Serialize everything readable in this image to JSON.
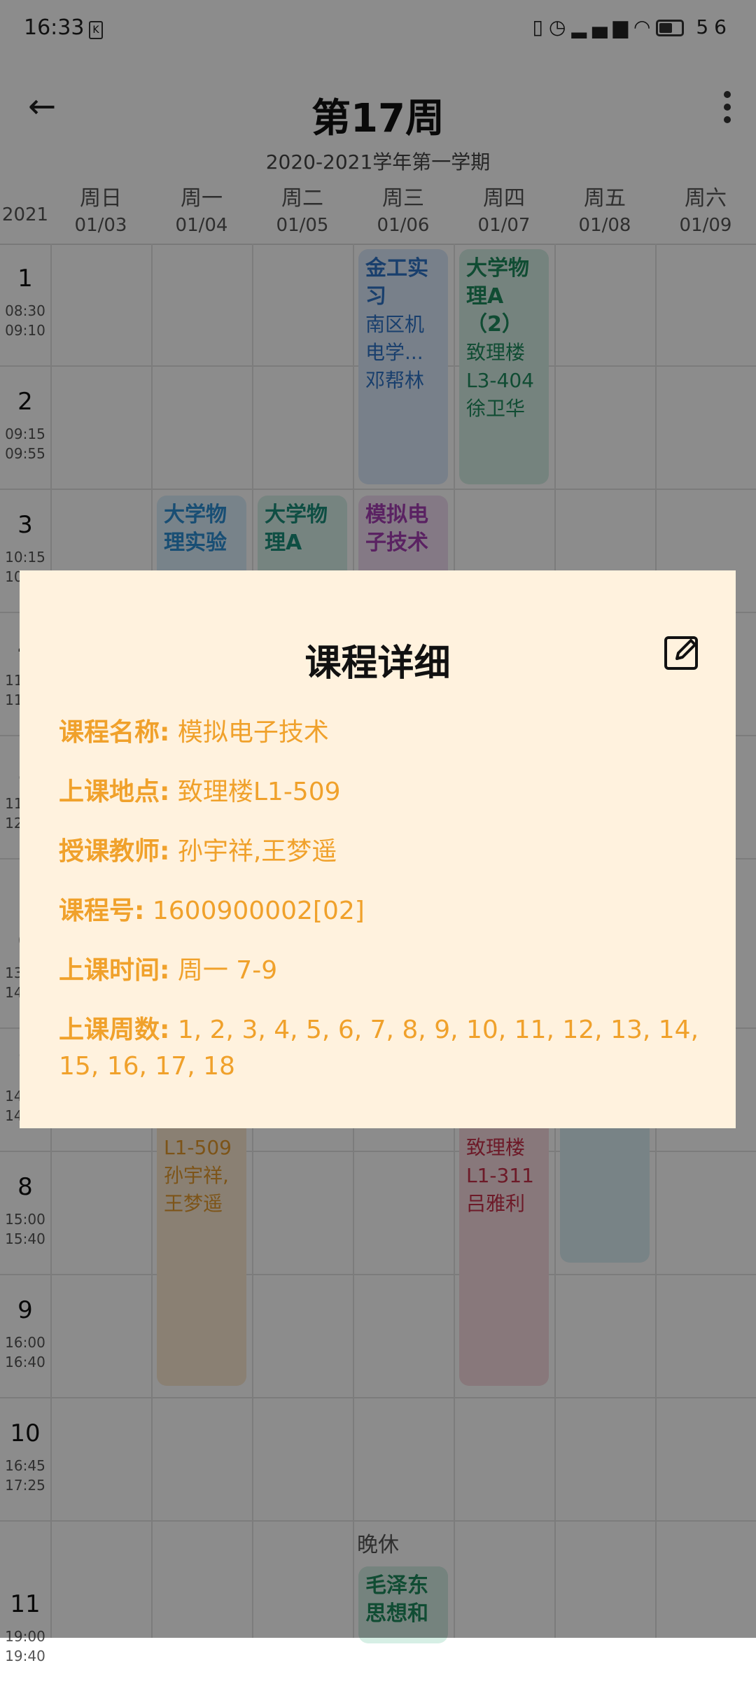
{
  "status_bar": {
    "time": "16:33",
    "battery": "56"
  },
  "header": {
    "title": "第17周",
    "subtitle": "2020-2021学年第一学期"
  },
  "day_header": {
    "year": "2021",
    "days": [
      {
        "name": "周日",
        "date": "01/03"
      },
      {
        "name": "周一",
        "date": "01/04"
      },
      {
        "name": "周二",
        "date": "01/05"
      },
      {
        "name": "周三",
        "date": "01/06"
      },
      {
        "name": "周四",
        "date": "01/07"
      },
      {
        "name": "周五",
        "date": "01/08"
      },
      {
        "name": "周六",
        "date": "01/09"
      }
    ]
  },
  "periods": [
    {
      "num": "1",
      "start": "08:30",
      "end": "09:10"
    },
    {
      "num": "2",
      "start": "09:15",
      "end": "09:55"
    },
    {
      "num": "3",
      "start": "10:15",
      "end": "10:55"
    },
    {
      "num": "4",
      "start": "11:00",
      "end": "11:40"
    },
    {
      "num": "5",
      "start": "11:45",
      "end": "12:25"
    },
    {
      "num": "6",
      "start": "13:30",
      "end": "14:10"
    },
    {
      "num": "7",
      "start": "14:15",
      "end": "14:55"
    },
    {
      "num": "8",
      "start": "15:00",
      "end": "15:40"
    },
    {
      "num": "9",
      "start": "16:00",
      "end": "16:40"
    },
    {
      "num": "10",
      "start": "16:45",
      "end": "17:25"
    },
    {
      "num": "11",
      "start": "19:00",
      "end": "19:40"
    }
  ],
  "break_label": "晚休",
  "courses": {
    "c1": {
      "name": "金工实习",
      "room": "南区机电学...",
      "teacher": "邓帮林"
    },
    "c2": {
      "name": "大学物理A（2）",
      "room": "致理楼L3-404",
      "teacher": "徐卫华"
    },
    "c3": {
      "name": "大学物理实验",
      "room": "",
      "teacher": ""
    },
    "c4": {
      "name": "大学物理A",
      "room": "",
      "teacher": ""
    },
    "c5": {
      "name": "模拟电子技术",
      "room": "",
      "teacher": ""
    },
    "c6": {
      "name": "",
      "room": "L1-509",
      "teacher": "孙宇祥,王梦遥"
    },
    "c7": {
      "name": "",
      "room": "致理楼L1-311",
      "teacher": "吕雅利"
    },
    "c8": {
      "name": "毛泽东思想和",
      "room": "",
      "teacher": ""
    }
  },
  "dialog": {
    "title": "课程详细",
    "rows": [
      {
        "label": "课程名称:",
        "value": "模拟电子技术"
      },
      {
        "label": "上课地点:",
        "value": "致理楼L1-509"
      },
      {
        "label": "授课教师:",
        "value": "孙宇祥,王梦遥"
      },
      {
        "label": "课程号:",
        "value": "1600900002[02]"
      },
      {
        "label": "上课时间:",
        "value": "周一 7-9"
      },
      {
        "label": "上课周数:",
        "value": "1, 2, 3, 4, 5, 6, 7, 8, 9, 10, 11, 12, 13, 14, 15, 16, 17, 18"
      }
    ]
  }
}
